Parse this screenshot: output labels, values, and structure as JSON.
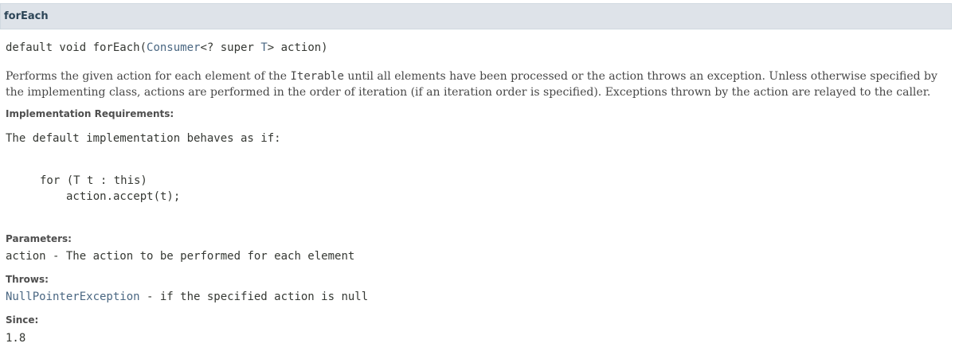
{
  "header": {
    "title": "forEach"
  },
  "signature": {
    "prefix": "default void forEach(",
    "type_link": "Consumer",
    "mid": "<? super ",
    "param_link": "T",
    "suffix": "> action)"
  },
  "description": {
    "part1": "Performs the given action for each element of the ",
    "code": "Iterable",
    "part2": " until all elements have been processed or the action throws an exception. Unless otherwise specified by the implementing class, actions are performed in the order of iteration (if an iteration order is specified). Exceptions thrown by the action are relayed to the caller."
  },
  "impl_requirements": {
    "label": "Implementation Requirements:",
    "text": "The default implementation behaves as if:",
    "code_line1": "for (T t : this)",
    "code_line2": "action.accept(t);"
  },
  "parameters": {
    "label": "Parameters:",
    "name": "action",
    "text": " - The action to be performed for each element"
  },
  "throws": {
    "label": "Throws:",
    "exception_link": "NullPointerException",
    "text": " - if the specified action is null"
  },
  "since": {
    "label": "Since:",
    "value": "1.8"
  }
}
